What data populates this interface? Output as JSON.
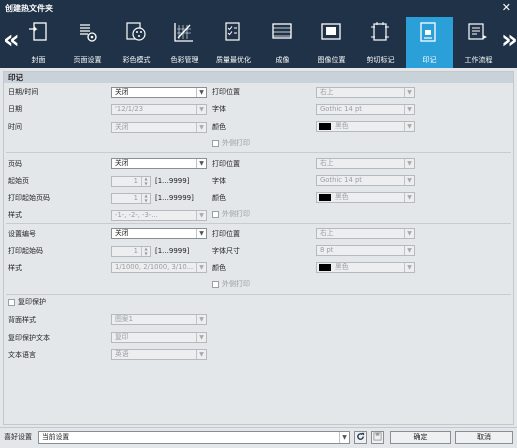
{
  "window": {
    "title": "创建热文件夹",
    "close": "✕"
  },
  "tabs": [
    {
      "label": "封面",
      "icon": "cover-icon"
    },
    {
      "label": "页面设置",
      "icon": "page-setup-icon"
    },
    {
      "label": "彩色模式",
      "icon": "color-mode-icon"
    },
    {
      "label": "色彩管理",
      "icon": "color-management-icon"
    },
    {
      "label": "质量最优化",
      "icon": "quality-icon"
    },
    {
      "label": "成像",
      "icon": "imaging-icon"
    },
    {
      "label": "图像位置",
      "icon": "image-position-icon"
    },
    {
      "label": "剪切标记",
      "icon": "crop-marks-icon"
    },
    {
      "label": "印记",
      "icon": "stamp-icon"
    },
    {
      "label": "工作流程",
      "icon": "workflow-icon"
    }
  ],
  "section": {
    "title": "印记"
  },
  "datetime": {
    "label": "日期/时间",
    "value": "关闭",
    "date_label": "日期",
    "date_value": "'12/1/23",
    "time_label": "时间",
    "time_value": "关闭",
    "pos_label": "打印位置",
    "pos_value": "右上",
    "font_label": "字体",
    "font_value": "Gothic 14 pt",
    "color_label": "颜色",
    "color_value": "黑色",
    "outside_label": "外侧打印"
  },
  "page": {
    "label": "页码",
    "value": "关闭",
    "start_label": "起始页",
    "start_value": "1",
    "start_range": "[1...9999]",
    "start_num_label": "打印起始页码",
    "start_num_value": "1",
    "start_num_range": "[1...99999]",
    "style_label": "样式",
    "style_value": "-1-, -2-, -3-...",
    "pos_label": "打印位置",
    "pos_value": "右上",
    "font_label": "字体",
    "font_value": "Gothic 14 pt",
    "color_label": "颜色",
    "color_value": "黑色",
    "outside_label": "外侧打印"
  },
  "setnum": {
    "label": "设置编号",
    "value": "关闭",
    "start_label": "打印起始码",
    "start_value": "1",
    "start_range": "[1...9999]",
    "style_label": "样式",
    "style_value": "1/1000, 2/1000, 3/10...",
    "pos_label": "打印位置",
    "pos_value": "右上",
    "size_label": "字体尺寸",
    "size_value": "8 pt",
    "color_label": "颜色",
    "color_value": "黑色",
    "outside_label": "外侧打印"
  },
  "copyprotect": {
    "label": "复印保护",
    "bg_label": "背面样式",
    "bg_value": "图案1",
    "text_label": "复印保护文本",
    "text_value": "复印",
    "lang_label": "文本语言",
    "lang_value": "英语"
  },
  "bottom": {
    "fav_label": "喜好设置",
    "fav_value": "当前设置",
    "ok": "确定",
    "cancel": "取消"
  },
  "colors": {
    "titlebar": "#1f3247",
    "active_tab": "#2a9fd8"
  }
}
